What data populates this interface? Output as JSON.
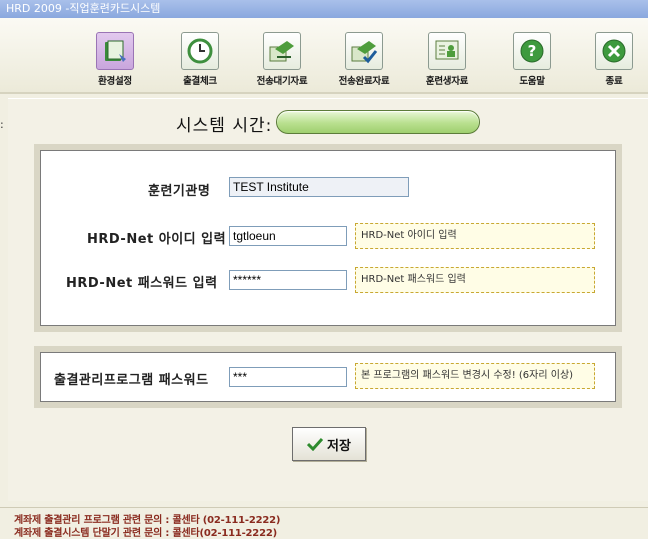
{
  "window": {
    "title": "HRD 2009 -직업훈련카드시스템"
  },
  "toolbar": {
    "buttons": [
      {
        "label": "환경설정",
        "icon": "settings-book-icon"
      },
      {
        "label": "출결체크",
        "icon": "clock-icon"
      },
      {
        "label": "전송대기자료",
        "icon": "pending-transfer-icon"
      },
      {
        "label": "전송완료자료",
        "icon": "transfer-complete-icon"
      },
      {
        "label": "훈련생자료",
        "icon": "trainee-data-icon"
      },
      {
        "label": "도움말",
        "icon": "help-icon"
      },
      {
        "label": "종료",
        "icon": "exit-icon"
      }
    ]
  },
  "system_time": {
    "label": "시스템 시간:"
  },
  "form": {
    "institution": {
      "label": "훈련기관명",
      "value": "TEST Institute"
    },
    "hrd_id": {
      "label": "HRD-Net 아이디 입력",
      "value": "tgtloeun",
      "hint": "HRD-Net 아이디 입력"
    },
    "hrd_password": {
      "label": "HRD-Net 패스워드 입력",
      "value": "******",
      "hint": "HRD-Net 패스워드 입력"
    },
    "program_password": {
      "label": "출결관리프로그램 패스워드",
      "value": "***",
      "hint": "본 프로그램의 패스워드 변경시 수정! (6자리 이상)"
    }
  },
  "save_button": {
    "label": "저장"
  },
  "footer": {
    "line1": "계좌제 출결관리 프로그램 관련 문의 : 콜센타 (02-111-2222)",
    "line2": "계좌제 출결시스템 단말기 관련 문의 : 콜센타(02-111-2222)"
  },
  "colors": {
    "accent_green": "#9fcf6f",
    "hint_bg": "#fffde6",
    "footer_text": "#8a2b1f"
  }
}
